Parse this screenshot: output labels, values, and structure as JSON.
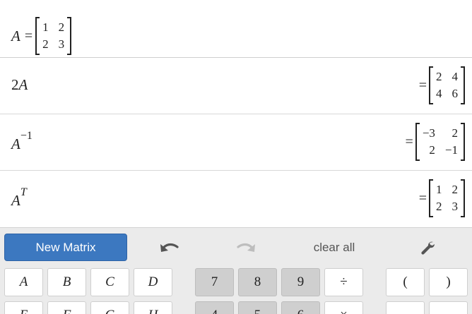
{
  "expressions": [
    {
      "lhs_main": "A",
      "lhs_sup": "",
      "definition": true,
      "matrix": [
        [
          "1",
          "2"
        ],
        [
          "2",
          "3"
        ]
      ]
    },
    {
      "lhs_main": "2A",
      "lhs_sup": "",
      "definition": false,
      "matrix": [
        [
          "2",
          "4"
        ],
        [
          "4",
          "6"
        ]
      ]
    },
    {
      "lhs_main": "A",
      "lhs_sup": "−1",
      "definition": false,
      "matrix": [
        [
          "−3",
          "2"
        ],
        [
          "2",
          "−1"
        ]
      ]
    },
    {
      "lhs_main": "A",
      "lhs_sup": "T",
      "definition": false,
      "matrix": [
        [
          "1",
          "2"
        ],
        [
          "2",
          "3"
        ]
      ]
    }
  ],
  "equals_sign": "=",
  "toolbar": {
    "new_matrix_label": "New Matrix",
    "clear_all_label": "clear all"
  },
  "keys": {
    "row1": [
      "A",
      "B",
      "C",
      "D",
      "7",
      "8",
      "9",
      "÷",
      "(",
      ")"
    ],
    "row2": [
      "E",
      "F",
      "G",
      "H",
      "4",
      "5",
      "6",
      "×",
      "←",
      "→"
    ]
  },
  "colors": {
    "accent": "#3c78c0",
    "keypad_bg": "#ebebeb",
    "digit_key": "#cfcfcf"
  }
}
